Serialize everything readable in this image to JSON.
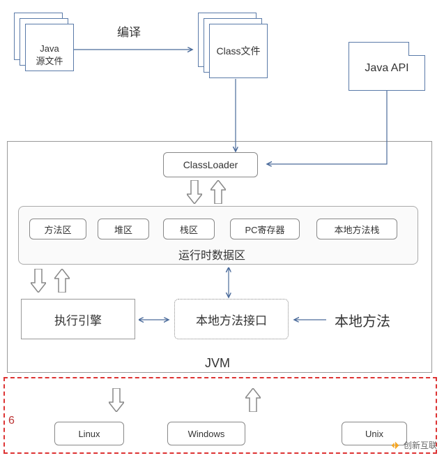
{
  "nodes": {
    "javaSource": {
      "line1": "Java",
      "line2": "源文件"
    },
    "classFile": "Class文件",
    "javaApi": "Java API",
    "classLoader": "ClassLoader",
    "runtimeArea": "运行时数据区",
    "methodArea": "方法区",
    "heap": "堆区",
    "stack": "栈区",
    "pcRegister": "PC寄存器",
    "nativeStack": "本地方法栈",
    "execEngine": "执行引擎",
    "nativeInterface": "本地方法接口",
    "nativeMethod": "本地方法",
    "jvmLabel": "JVM",
    "linux": "Linux",
    "windows": "Windows",
    "unix": "Unix"
  },
  "labels": {
    "compile": "编译",
    "corner": "6"
  },
  "chart_data": {
    "type": "diagram",
    "title": "JVM Architecture",
    "nodes": [
      {
        "id": "java_source",
        "label": "Java 源文件",
        "type": "stack"
      },
      {
        "id": "class_file",
        "label": "Class文件",
        "type": "stack"
      },
      {
        "id": "java_api",
        "label": "Java API",
        "type": "box"
      },
      {
        "id": "classloader",
        "label": "ClassLoader",
        "type": "box"
      },
      {
        "id": "runtime_area",
        "label": "运行时数据区",
        "type": "container",
        "children": [
          "method_area",
          "heap",
          "stack",
          "pc_register",
          "native_stack"
        ]
      },
      {
        "id": "method_area",
        "label": "方法区",
        "type": "box"
      },
      {
        "id": "heap",
        "label": "堆区",
        "type": "box"
      },
      {
        "id": "stack",
        "label": "栈区",
        "type": "box"
      },
      {
        "id": "pc_register",
        "label": "PC寄存器",
        "type": "box"
      },
      {
        "id": "native_stack",
        "label": "本地方法栈",
        "type": "box"
      },
      {
        "id": "exec_engine",
        "label": "执行引擎",
        "type": "box"
      },
      {
        "id": "native_interface",
        "label": "本地方法接口",
        "type": "box-dotted"
      },
      {
        "id": "native_method",
        "label": "本地方法",
        "type": "text"
      },
      {
        "id": "jvm",
        "label": "JVM",
        "type": "container"
      },
      {
        "id": "os_layer",
        "label": "",
        "type": "container-dashed",
        "children": [
          "linux",
          "windows",
          "unix"
        ]
      },
      {
        "id": "linux",
        "label": "Linux",
        "type": "box"
      },
      {
        "id": "windows",
        "label": "Windows",
        "type": "box"
      },
      {
        "id": "unix",
        "label": "Unix",
        "type": "box"
      }
    ],
    "edges": [
      {
        "from": "java_source",
        "to": "class_file",
        "label": "编译",
        "style": "arrow"
      },
      {
        "from": "class_file",
        "to": "classloader",
        "style": "arrow"
      },
      {
        "from": "java_api",
        "to": "classloader",
        "style": "arrow"
      },
      {
        "from": "classloader",
        "to": "runtime_area",
        "style": "hollow-bidir"
      },
      {
        "from": "runtime_area",
        "to": "exec_engine",
        "style": "hollow-bidir"
      },
      {
        "from": "exec_engine",
        "to": "native_interface",
        "style": "arrow-bidir"
      },
      {
        "from": "runtime_area",
        "to": "native_interface",
        "style": "arrow-bidir"
      },
      {
        "from": "native_method",
        "to": "native_interface",
        "style": "arrow"
      },
      {
        "from": "jvm",
        "to": "os_layer",
        "style": "hollow-bidir"
      }
    ]
  },
  "watermark": "创新互联"
}
